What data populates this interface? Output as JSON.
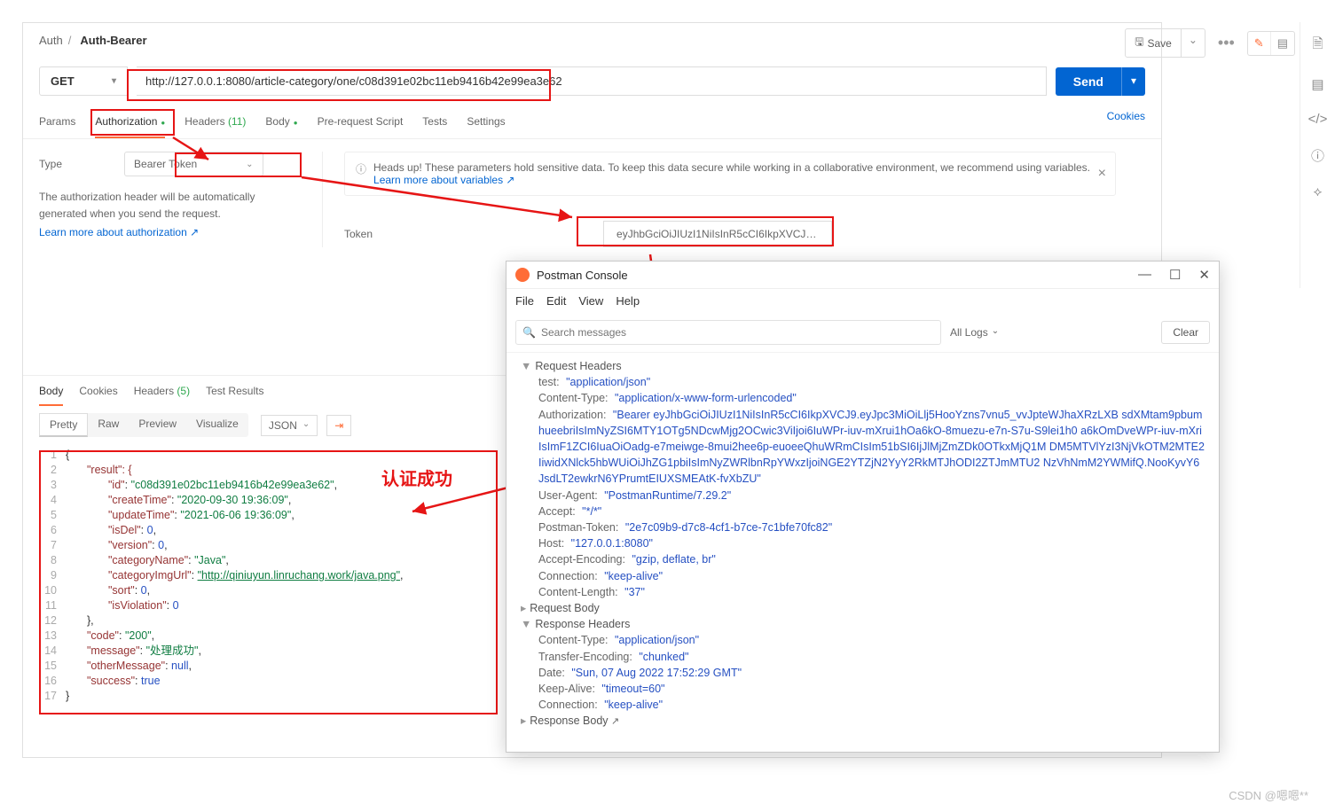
{
  "breadcrumb": {
    "parent": "Auth",
    "current": "Auth-Bearer"
  },
  "topActions": {
    "save": "Save"
  },
  "request": {
    "method": "GET",
    "url": "http://127.0.0.1:8080/article-category/one/c08d391e02bc11eb9416b42e99ea3e62",
    "send": "Send"
  },
  "tabs": {
    "params": "Params",
    "auth": "Authorization",
    "headers": "Headers",
    "headersCount": "(11)",
    "body": "Body",
    "pre": "Pre-request Script",
    "tests": "Tests",
    "settings": "Settings",
    "cookies": "Cookies"
  },
  "auth": {
    "typeLabel": "Type",
    "typeValue": "Bearer Token",
    "hint": "The authorization header will be automatically generated when you send the request.",
    "learn": "Learn more about authorization ↗",
    "tokenLabel": "Token",
    "tokenValue": "eyJhbGciOiJIUzI1NiIsInR5cCI6IkpXVCJ9.ey…",
    "headsup": "Heads up! These parameters hold sensitive data. To keep this data secure while working in a collaborative environment, we recommend using variables.",
    "headsupLink": "Learn more about variables ↗"
  },
  "respTabs": {
    "body": "Body",
    "cookies": "Cookies",
    "headers": "Headers",
    "headersCount": "(5)",
    "test": "Test Results"
  },
  "prettyBar": {
    "pretty": "Pretty",
    "raw": "Raw",
    "preview": "Preview",
    "vis": "Visualize",
    "json": "JSON"
  },
  "response": {
    "result_open": "\"result\": {",
    "id_k": "\"id\"",
    "id_v": "\"c08d391e02bc11eb9416b42e99ea3e62\"",
    "ct_k": "\"createTime\"",
    "ct_v": "\"2020-09-30 19:36:09\"",
    "ut_k": "\"updateTime\"",
    "ut_v": "\"2021-06-06 19:36:09\"",
    "isDel_k": "\"isDel\"",
    "isDel_v": "0",
    "ver_k": "\"version\"",
    "ver_v": "0",
    "cn_k": "\"categoryName\"",
    "cn_v": "\"Java\"",
    "ci_k": "\"categoryImgUrl\"",
    "ci_v": "\"http://qiniuyun.linruchang.work/java.png\"",
    "sort_k": "\"sort\"",
    "sort_v": "0",
    "iv_k": "\"isViolation\"",
    "iv_v": "0",
    "code_k": "\"code\"",
    "code_v": "\"200\"",
    "msg_k": "\"message\"",
    "msg_v": "\"处理成功\"",
    "om_k": "\"otherMessage\"",
    "om_v": "null",
    "suc_k": "\"success\"",
    "suc_v": "true"
  },
  "cnLabel": "认证成功",
  "console": {
    "title": "Postman Console",
    "menu": {
      "file": "File",
      "edit": "Edit",
      "view": "View",
      "help": "Help"
    },
    "searchPh": "Search messages",
    "allLogs": "All Logs",
    "clear": "Clear",
    "reqHdr": "Request Headers",
    "lines": {
      "test_k": "test:",
      "test_v": "\"application/json\"",
      "ct_k": "Content-Type:",
      "ct_v": "\"application/x-www-form-urlencoded\"",
      "auth_k": "Authorization:",
      "auth_v": "\"Bearer eyJhbGciOiJIUzI1NiIsInR5cCI6IkpXVCJ9.eyJpc3MiOiLlj5HooYzns7vnu5_vvJpteWJhaXRzLXB sdXMtam9pbumhueebriIsImNyZSI6MTY1OTg5NDcwMjg2OCwic3ViIjoi6IuWPr-iuv-mXrui1hOa6kO-8muezu-e7n-S7u-S9lei1h0 a6kOmDveWPr-iuv-mXriIsImF1ZCI6IuaOiOadg-e7meiwge-8mui2hee6p-euoeeQhuWRmCIsIm51bSI6IjJlMjZmZDk0OTkxMjQ1M DM5MTVlYzI3NjVkOTM2MTE2IiwidXNlck5hbWUiOiJhZG1pbiIsImNyZWRlbnRpYWxzIjoiNGE2YTZjN2YyY2RkMTJhODI2ZTJmMTU2 NzVhNmM2YWMifQ.NooKyvY6JsdLT2ewkrN6YPrumtEIUXSMEAtK-fvXbZU\"",
      "ua_k": "User-Agent:",
      "ua_v": "\"PostmanRuntime/7.29.2\"",
      "acc_k": "Accept:",
      "acc_v": "\"*/*\"",
      "pt_k": "Postman-Token:",
      "pt_v": "\"2e7c09b9-d7c8-4cf1-b7ce-7c1bfe70fc82\"",
      "host_k": "Host:",
      "host_v": "\"127.0.0.1:8080\"",
      "ae_k": "Accept-Encoding:",
      "ae_v": "\"gzip, deflate, br\"",
      "con_k": "Connection:",
      "con_v": "\"keep-alive\"",
      "cl_k": "Content-Length:",
      "cl_v": "\"37\""
    },
    "reqBody": "Request Body",
    "resHdr": "Response Headers",
    "res": {
      "ct_k": "Content-Type:",
      "ct_v": "\"application/json\"",
      "te_k": "Transfer-Encoding:",
      "te_v": "\"chunked\"",
      "date_k": "Date:",
      "date_v": "\"Sun, 07 Aug 2022 17:52:29 GMT\"",
      "ka_k": "Keep-Alive:",
      "ka_v": "\"timeout=60\"",
      "con_k": "Connection:",
      "con_v": "\"keep-alive\""
    },
    "resBody": "Response Body"
  },
  "watermark": "CSDN @嗯嗯**"
}
